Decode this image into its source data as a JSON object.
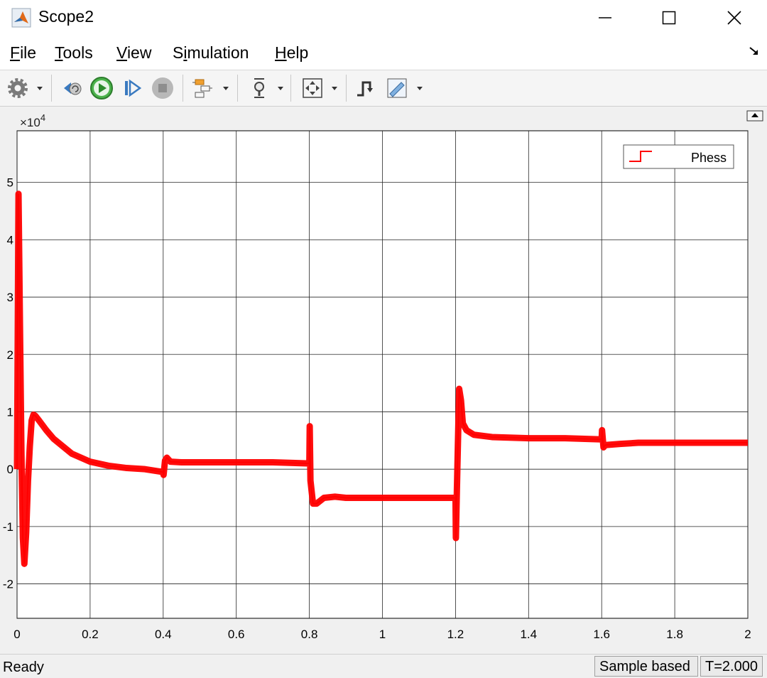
{
  "window": {
    "title": "Scope2"
  },
  "menu": {
    "items": [
      {
        "key": "F",
        "rest": "ile"
      },
      {
        "key": "T",
        "rest": "ools"
      },
      {
        "key": "V",
        "rest": "iew"
      },
      {
        "pre": "S",
        "key": "i",
        "rest": "mulation"
      },
      {
        "key": "H",
        "rest": "elp"
      }
    ]
  },
  "toolbar": {
    "icons": [
      "settings-icon",
      "step-back-icon",
      "run-icon",
      "step-forward-icon",
      "stop-icon",
      "signal-config-icon",
      "zoom-icon",
      "fit-to-view-icon",
      "triggers-icon",
      "measurements-icon"
    ]
  },
  "status": {
    "text": "Ready",
    "mode": "Sample based",
    "time": "T=2.000"
  },
  "chart_data": {
    "type": "line",
    "xlim": [
      0,
      2
    ],
    "ylim": [
      -2.6,
      5.9
    ],
    "y_exponent": "×10",
    "y_exponent_power": "4",
    "xticks": [
      "0",
      "0.2",
      "0.4",
      "0.6",
      "0.8",
      "1",
      "1.2",
      "1.4",
      "1.6",
      "1.8",
      "2"
    ],
    "yticks": [
      "-2",
      "-1",
      "0",
      "1",
      "2",
      "3",
      "4",
      "5"
    ],
    "grid": true,
    "legend_position": "top-right",
    "series": [
      {
        "name": "Phess",
        "color": "#ff0000",
        "x": [
          0,
          0.004,
          0.008,
          0.012,
          0.016,
          0.02,
          0.025,
          0.03,
          0.035,
          0.04,
          0.045,
          0.05,
          0.06,
          0.08,
          0.1,
          0.15,
          0.2,
          0.25,
          0.3,
          0.35,
          0.4,
          0.401,
          0.405,
          0.41,
          0.42,
          0.45,
          0.5,
          0.6,
          0.7,
          0.8,
          0.801,
          0.803,
          0.81,
          0.82,
          0.84,
          0.87,
          0.9,
          1.0,
          1.1,
          1.2,
          1.201,
          1.205,
          1.21,
          1.215,
          1.22,
          1.23,
          1.25,
          1.3,
          1.4,
          1.5,
          1.6,
          1.601,
          1.605,
          1.61,
          1.65,
          1.7,
          1.8,
          1.9,
          2.0
        ],
        "y": [
          0,
          4.8,
          2.5,
          0.3,
          -1.2,
          -1.65,
          -1.1,
          -0.2,
          0.4,
          0.85,
          0.95,
          0.93,
          0.85,
          0.68,
          0.53,
          0.27,
          0.13,
          0.06,
          0.02,
          0.0,
          -0.05,
          -0.1,
          0.15,
          0.2,
          0.13,
          0.12,
          0.12,
          0.12,
          0.12,
          0.1,
          0.75,
          -0.2,
          -0.6,
          -0.6,
          -0.5,
          -0.48,
          -0.5,
          -0.5,
          -0.5,
          -0.5,
          -1.2,
          0.0,
          1.4,
          1.2,
          0.8,
          0.68,
          0.6,
          0.56,
          0.54,
          0.54,
          0.52,
          0.68,
          0.38,
          0.42,
          0.44,
          0.46,
          0.46,
          0.46,
          0.46
        ]
      }
    ]
  }
}
